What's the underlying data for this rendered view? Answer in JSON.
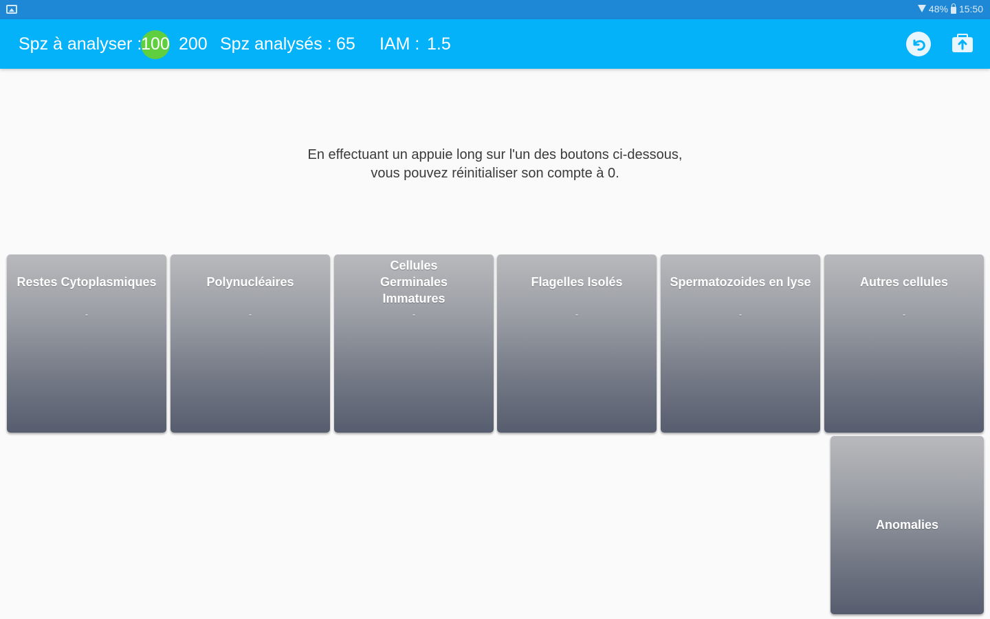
{
  "status_bar": {
    "battery": "48%",
    "time": "15:50"
  },
  "app_bar": {
    "to_analyze_label": "Spz à analyser :",
    "to_analyze_selected": "100",
    "to_analyze_alt": "200",
    "analyzed_label": "Spz analysés :",
    "analyzed_value": "65",
    "iam_label": "IAM :",
    "iam_value": "1.5",
    "selected_color": "#5fcf3f",
    "bar_color": "#04b2f9"
  },
  "instructions": {
    "line1": "En effectuant un appuie long sur l'un des boutons ci-dessous,",
    "line2": "vous pouvez réinitialiser son compte à 0."
  },
  "counters": [
    {
      "label_lines": [
        "Restes Cytoplasmiques"
      ],
      "count": "-"
    },
    {
      "label_lines": [
        "Polynucléaires"
      ],
      "count": "-"
    },
    {
      "label_lines": [
        "Cellules",
        "Germinales",
        "Immatures"
      ],
      "count": "-"
    },
    {
      "label_lines": [
        "Flagelles Isolés"
      ],
      "count": "-"
    },
    {
      "label_lines": [
        "Spermatozoides en lyse"
      ],
      "count": "-"
    },
    {
      "label_lines": [
        "Autres cellules"
      ],
      "count": "-"
    }
  ],
  "anomalies_button": {
    "label": "Anomalies"
  }
}
